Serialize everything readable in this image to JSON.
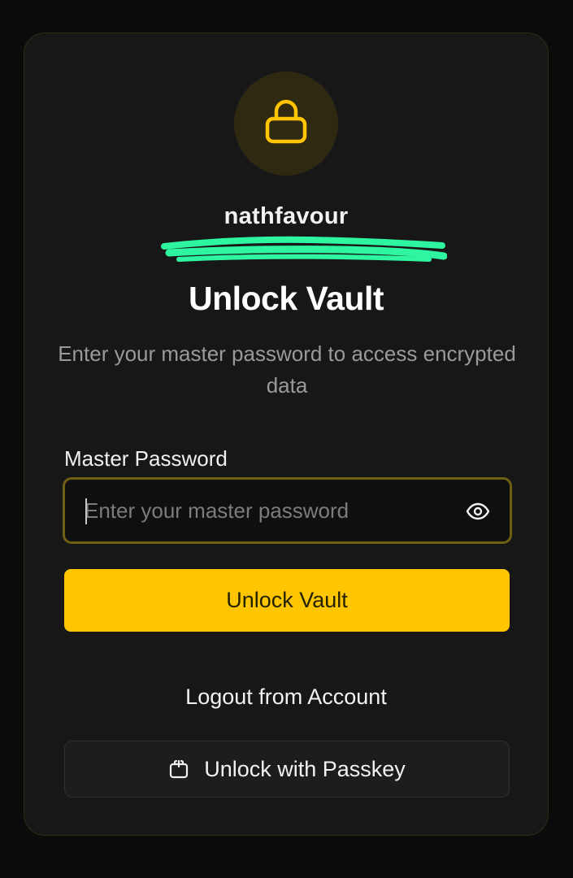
{
  "user": {
    "username": "nathfavour"
  },
  "header": {
    "title": "Unlock Vault",
    "subtitle": "Enter your master password to access encrypted data"
  },
  "form": {
    "password_label": "Master Password",
    "password_placeholder": "Enter your master password",
    "password_value": "",
    "submit_label": "Unlock Vault"
  },
  "actions": {
    "logout_label": "Logout from Account",
    "passkey_label": "Unlock with Passkey"
  },
  "icons": {
    "lock": "lock-icon",
    "eye": "eye-icon",
    "passkey": "passkey-icon"
  },
  "colors": {
    "accent": "#ffc501",
    "background": "#0b0b0b",
    "card": "#171717",
    "redaction": "#2ef5a0"
  }
}
